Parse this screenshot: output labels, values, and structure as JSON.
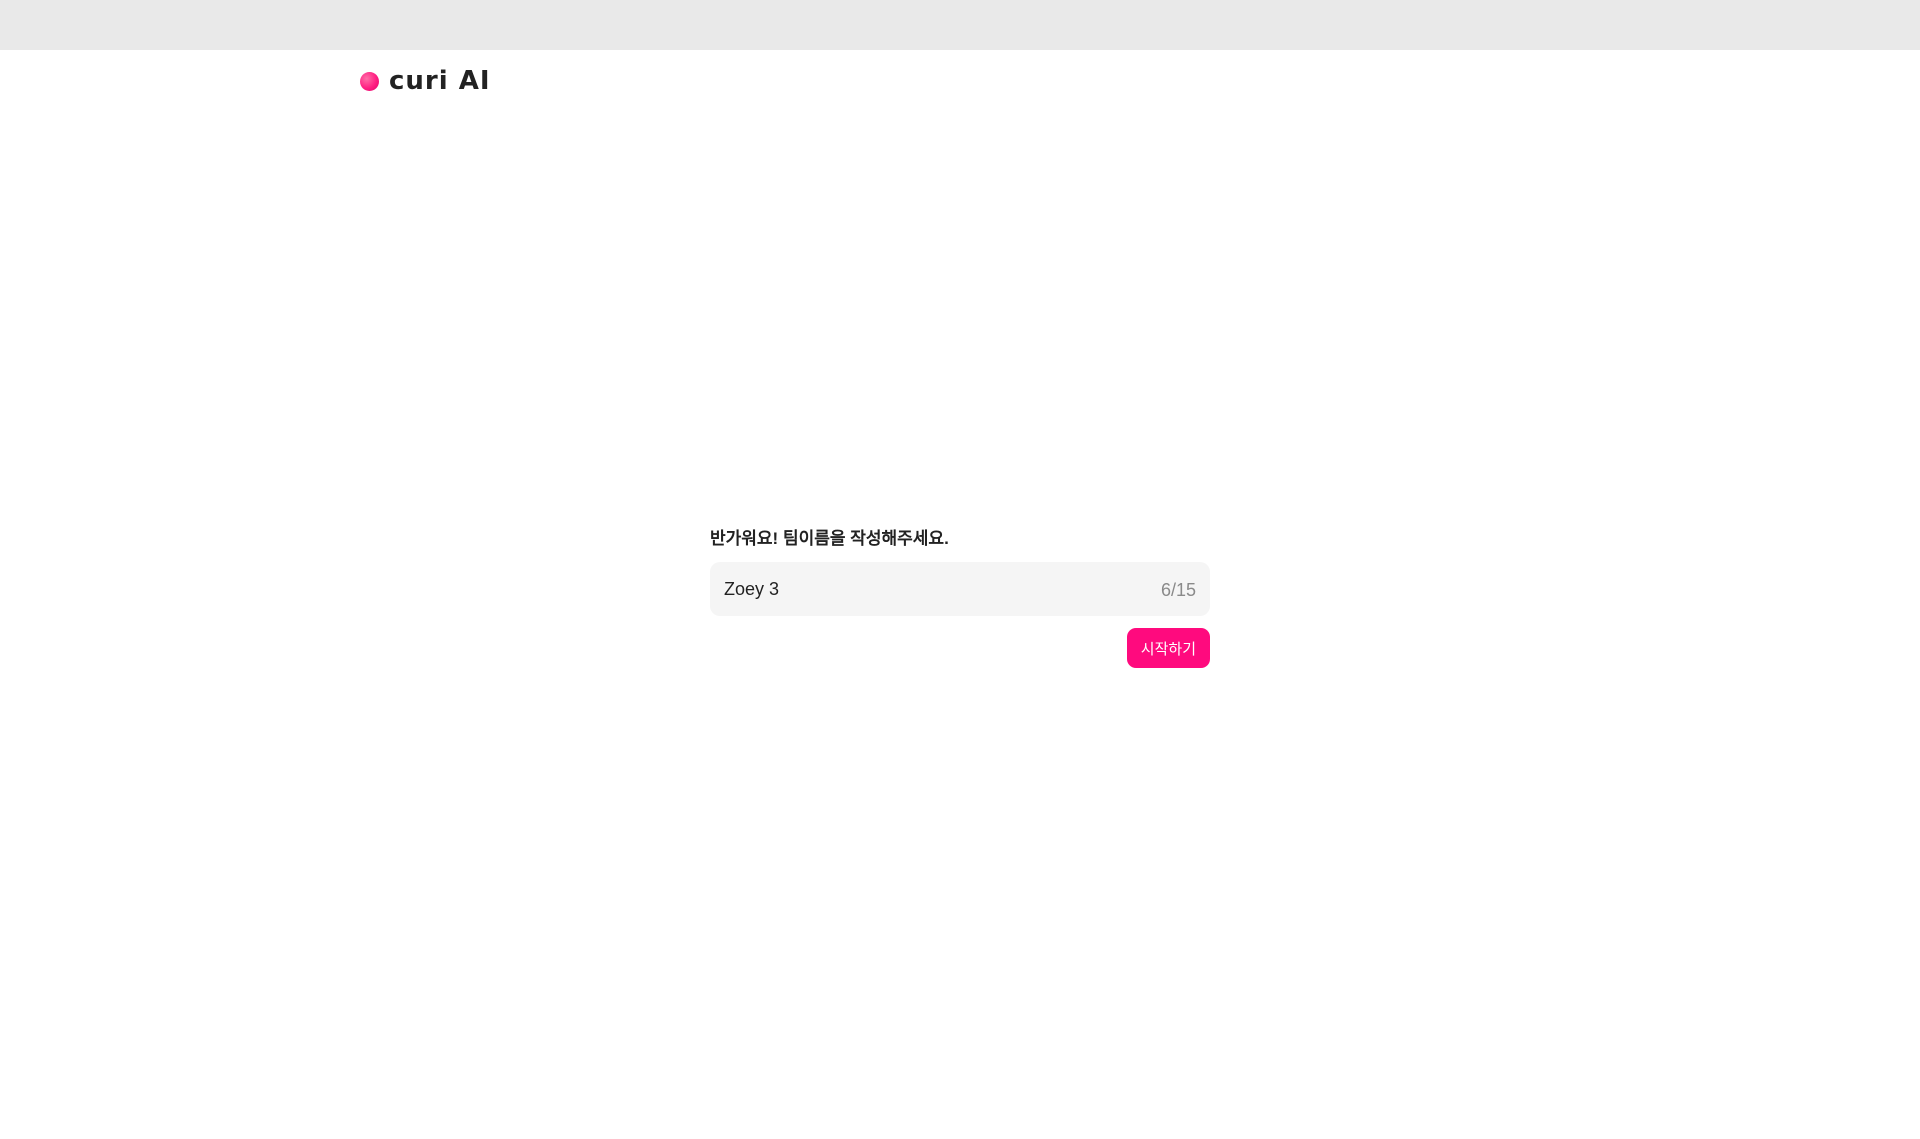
{
  "header": {
    "logo_text": "curi AI"
  },
  "form": {
    "prompt": "반가워요! 팀이름을 작성해주세요.",
    "team_name_value": "Zoey 3",
    "char_counter": "6/15",
    "start_button_label": "시작하기"
  },
  "colors": {
    "accent": "#ff0a7e",
    "top_bar": "#e9e9e9",
    "input_bg": "#f5f5f5"
  }
}
